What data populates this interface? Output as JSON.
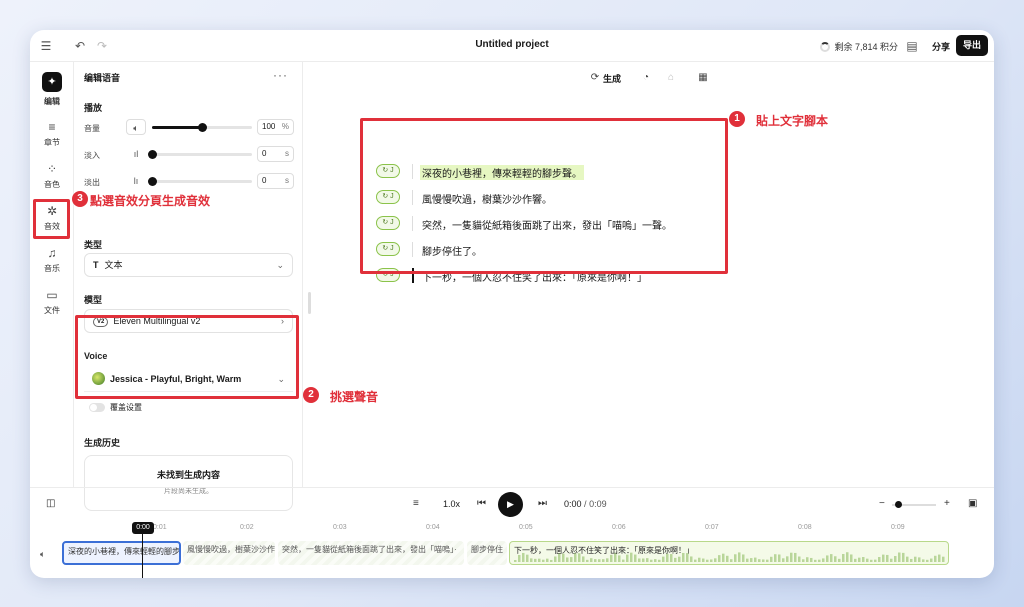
{
  "header": {
    "title": "Untitled project",
    "credits": "剩余 7,814 积分",
    "share": "分享",
    "export": "导出"
  },
  "rail": {
    "items": [
      {
        "label": "编辑",
        "icon": "logo-icon"
      },
      {
        "label": "章节",
        "icon": "list-icon"
      },
      {
        "label": "音色",
        "icon": "grid-icon"
      },
      {
        "label": "音效",
        "icon": "sparkle-icon"
      },
      {
        "label": "音乐",
        "icon": "music-icon"
      },
      {
        "label": "文件",
        "icon": "folder-icon"
      }
    ]
  },
  "panel": {
    "title": "编辑语音",
    "playback": {
      "heading": "播放",
      "volume": {
        "label": "音量",
        "value": "100",
        "unit": "%",
        "level": 0.5
      },
      "fade_in": {
        "label": "淡入",
        "value": "0",
        "unit": "s",
        "level": 0
      },
      "fade_out": {
        "label": "淡出",
        "value": "0",
        "unit": "s",
        "level": 0
      }
    },
    "type": {
      "heading": "类型",
      "value": "文本"
    },
    "model": {
      "heading": "模型",
      "badge": "V2",
      "value": "Eleven Multilingual v2"
    },
    "voice": {
      "heading": "Voice",
      "value": "Jessica - Playful, Bright, Warm",
      "override": "覆盖设置"
    },
    "history": {
      "heading": "生成历史",
      "empty_title": "未找到生成内容",
      "empty_sub": "片段尚未生成。"
    }
  },
  "toolbar": {
    "generate": "生成"
  },
  "script": {
    "speaker_tag": "J",
    "lines": [
      "深夜的小巷裡，傳來輕輕的腳步聲。",
      "風慢慢吹過，樹葉沙沙作響。",
      "突然，一隻貓從紙箱後面跳了出來，發出「喵嗚」一聲。",
      "腳步停住了。",
      "下一秒，一個人忍不住笑了出來：「原來是你啊！」"
    ]
  },
  "annotations": [
    {
      "num": "1",
      "text": "貼上文字腳本"
    },
    {
      "num": "2",
      "text": "挑選聲音"
    },
    {
      "num": "3",
      "text": "點選音效分頁生成音效"
    }
  ],
  "player": {
    "speed": "1.0x",
    "current": "0:00",
    "separator": "/",
    "total": "0:09"
  },
  "timeline": {
    "playhead": "0:00",
    "ticks": [
      "0:01",
      "0:02",
      "0:03",
      "0:04",
      "0:05",
      "0:06",
      "0:07",
      "0:08",
      "0:09"
    ],
    "clips": [
      "深夜的小巷裡，傳來輕輕的腳步",
      "風慢慢吹過，樹葉沙沙作",
      "突然，一隻貓從紙箱後面跳了出來，發出「喵嗚」·",
      "腳步停住",
      "下一秒，一個人忍不住笑了出來：「原來是你啊！」"
    ]
  },
  "colors": {
    "accent_red": "#e0303a",
    "highlight": "#e6f7c2",
    "active_clip": "#3b6fd6"
  }
}
